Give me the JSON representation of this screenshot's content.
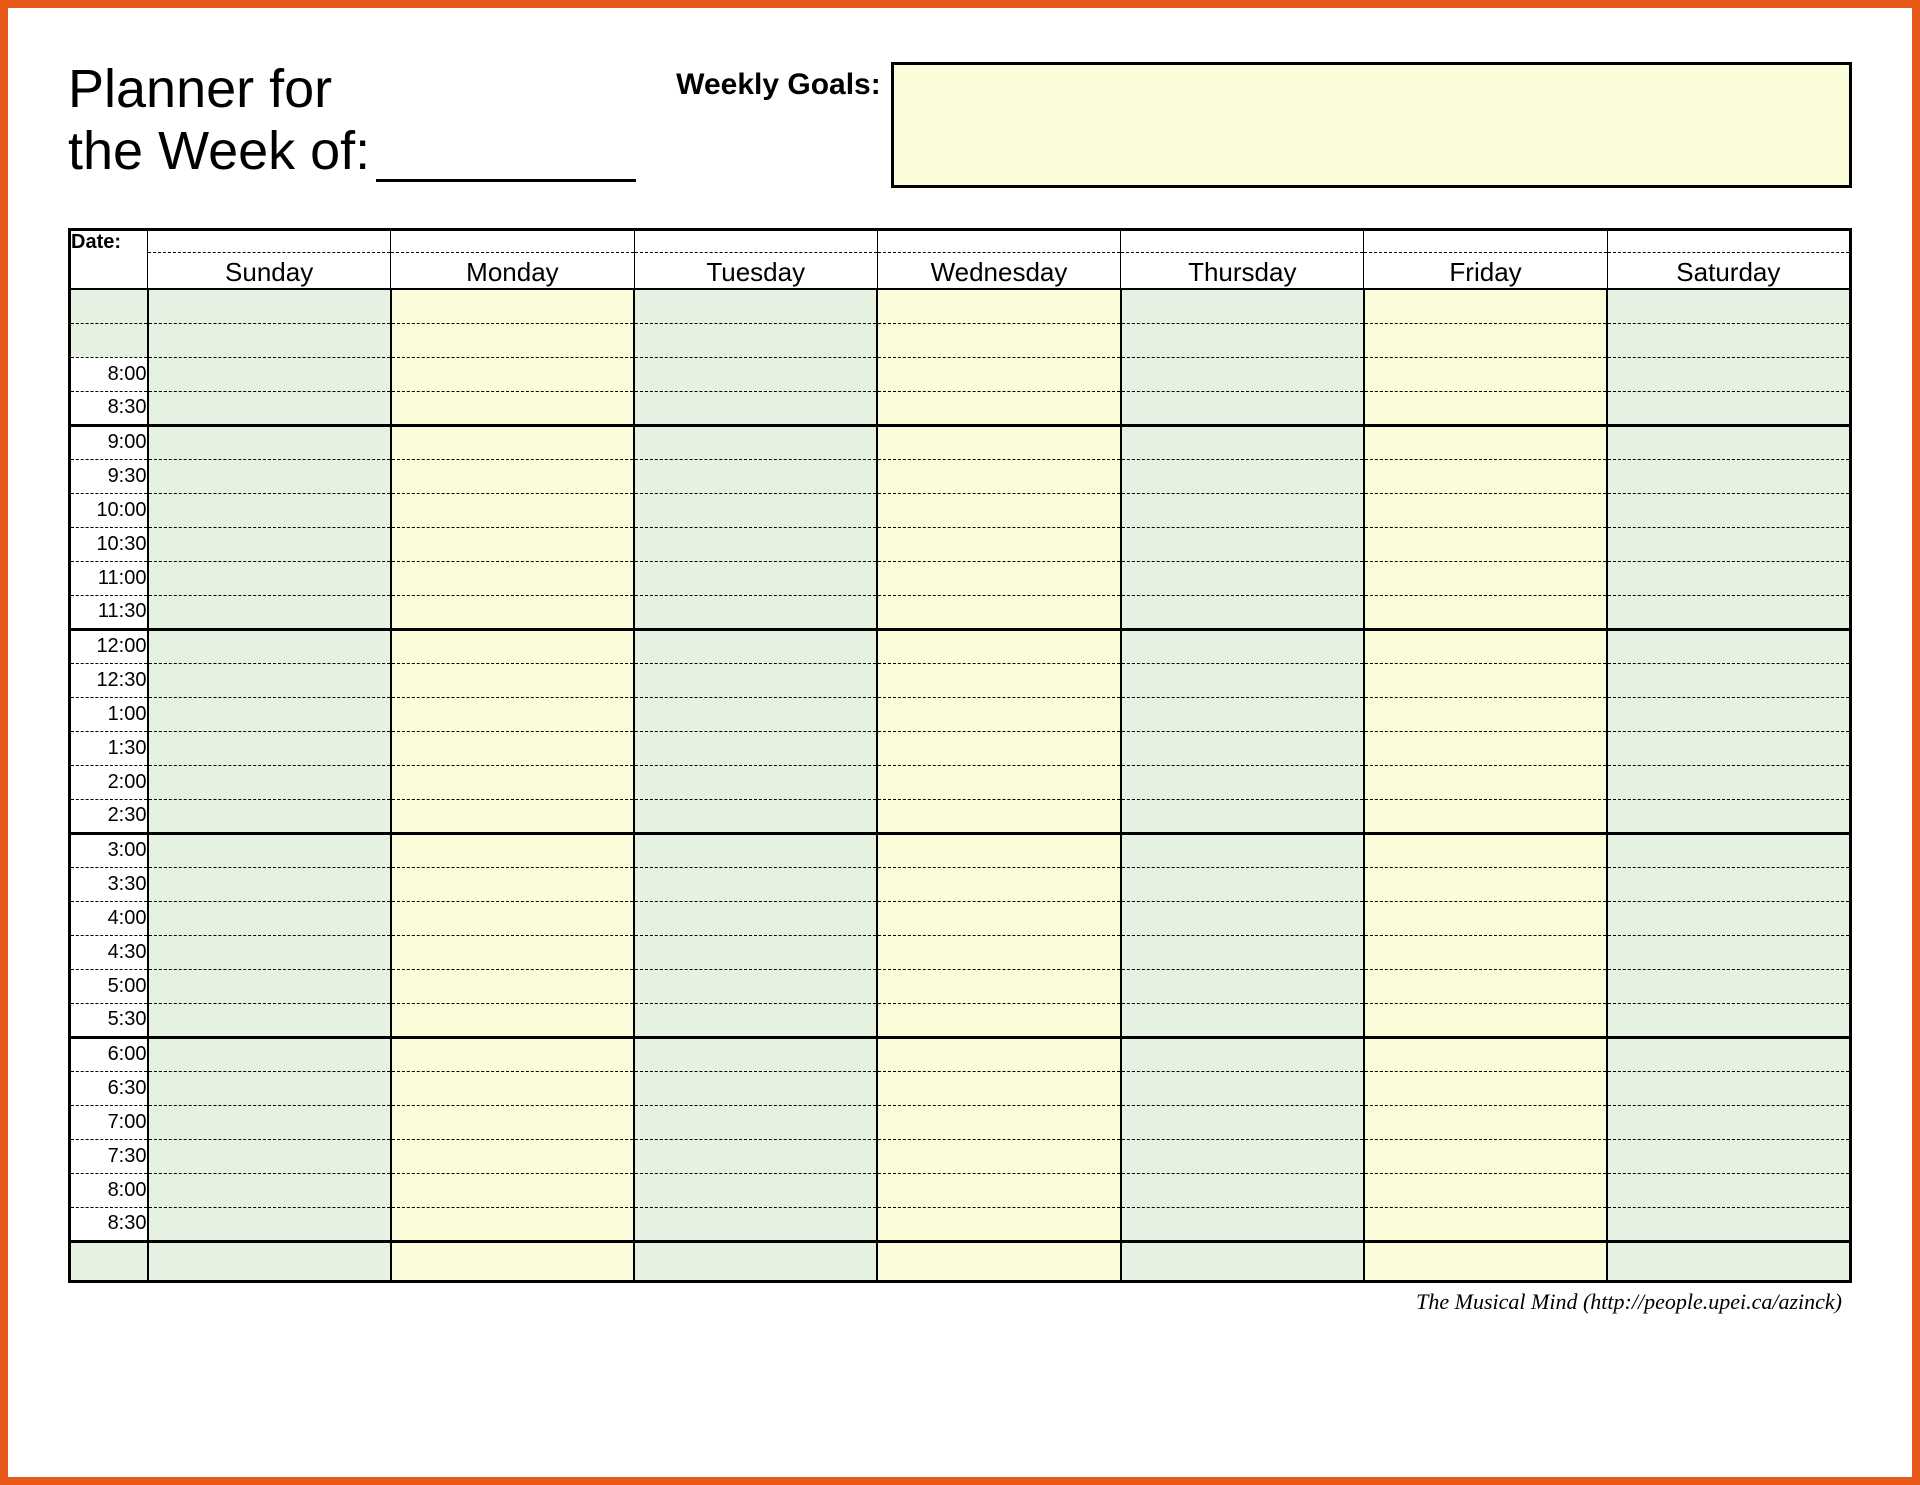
{
  "header": {
    "title_line1": "Planner for",
    "title_line2_prefix": "the Week of:",
    "goals_label": "Weekly Goals:",
    "goals_value": ""
  },
  "table": {
    "corner_label": "Date:",
    "days": [
      "Sunday",
      "Monday",
      "Tuesday",
      "Wednesday",
      "Thursday",
      "Friday",
      "Saturday"
    ],
    "blank_rows_before": 2,
    "times": [
      "8:00",
      "8:30",
      "9:00",
      "9:30",
      "10:00",
      "10:30",
      "11:00",
      "11:30",
      "12:00",
      "12:30",
      "1:00",
      "1:30",
      "2:00",
      "2:30",
      "3:00",
      "3:30",
      "4:00",
      "4:30",
      "5:00",
      "5:30",
      "6:00",
      "6:30",
      "7:00",
      "7:30",
      "8:00",
      "8:30"
    ],
    "block_end_times": [
      "8:30",
      "11:30",
      "2:30",
      "5:30",
      "8:30"
    ]
  },
  "colors": {
    "green": "#e5f1e1",
    "yellow": "#fbfcda",
    "frame": "#e85a1a"
  },
  "footer": {
    "credit": "The Musical Mind  (http://people.upei.ca/azinck)"
  }
}
